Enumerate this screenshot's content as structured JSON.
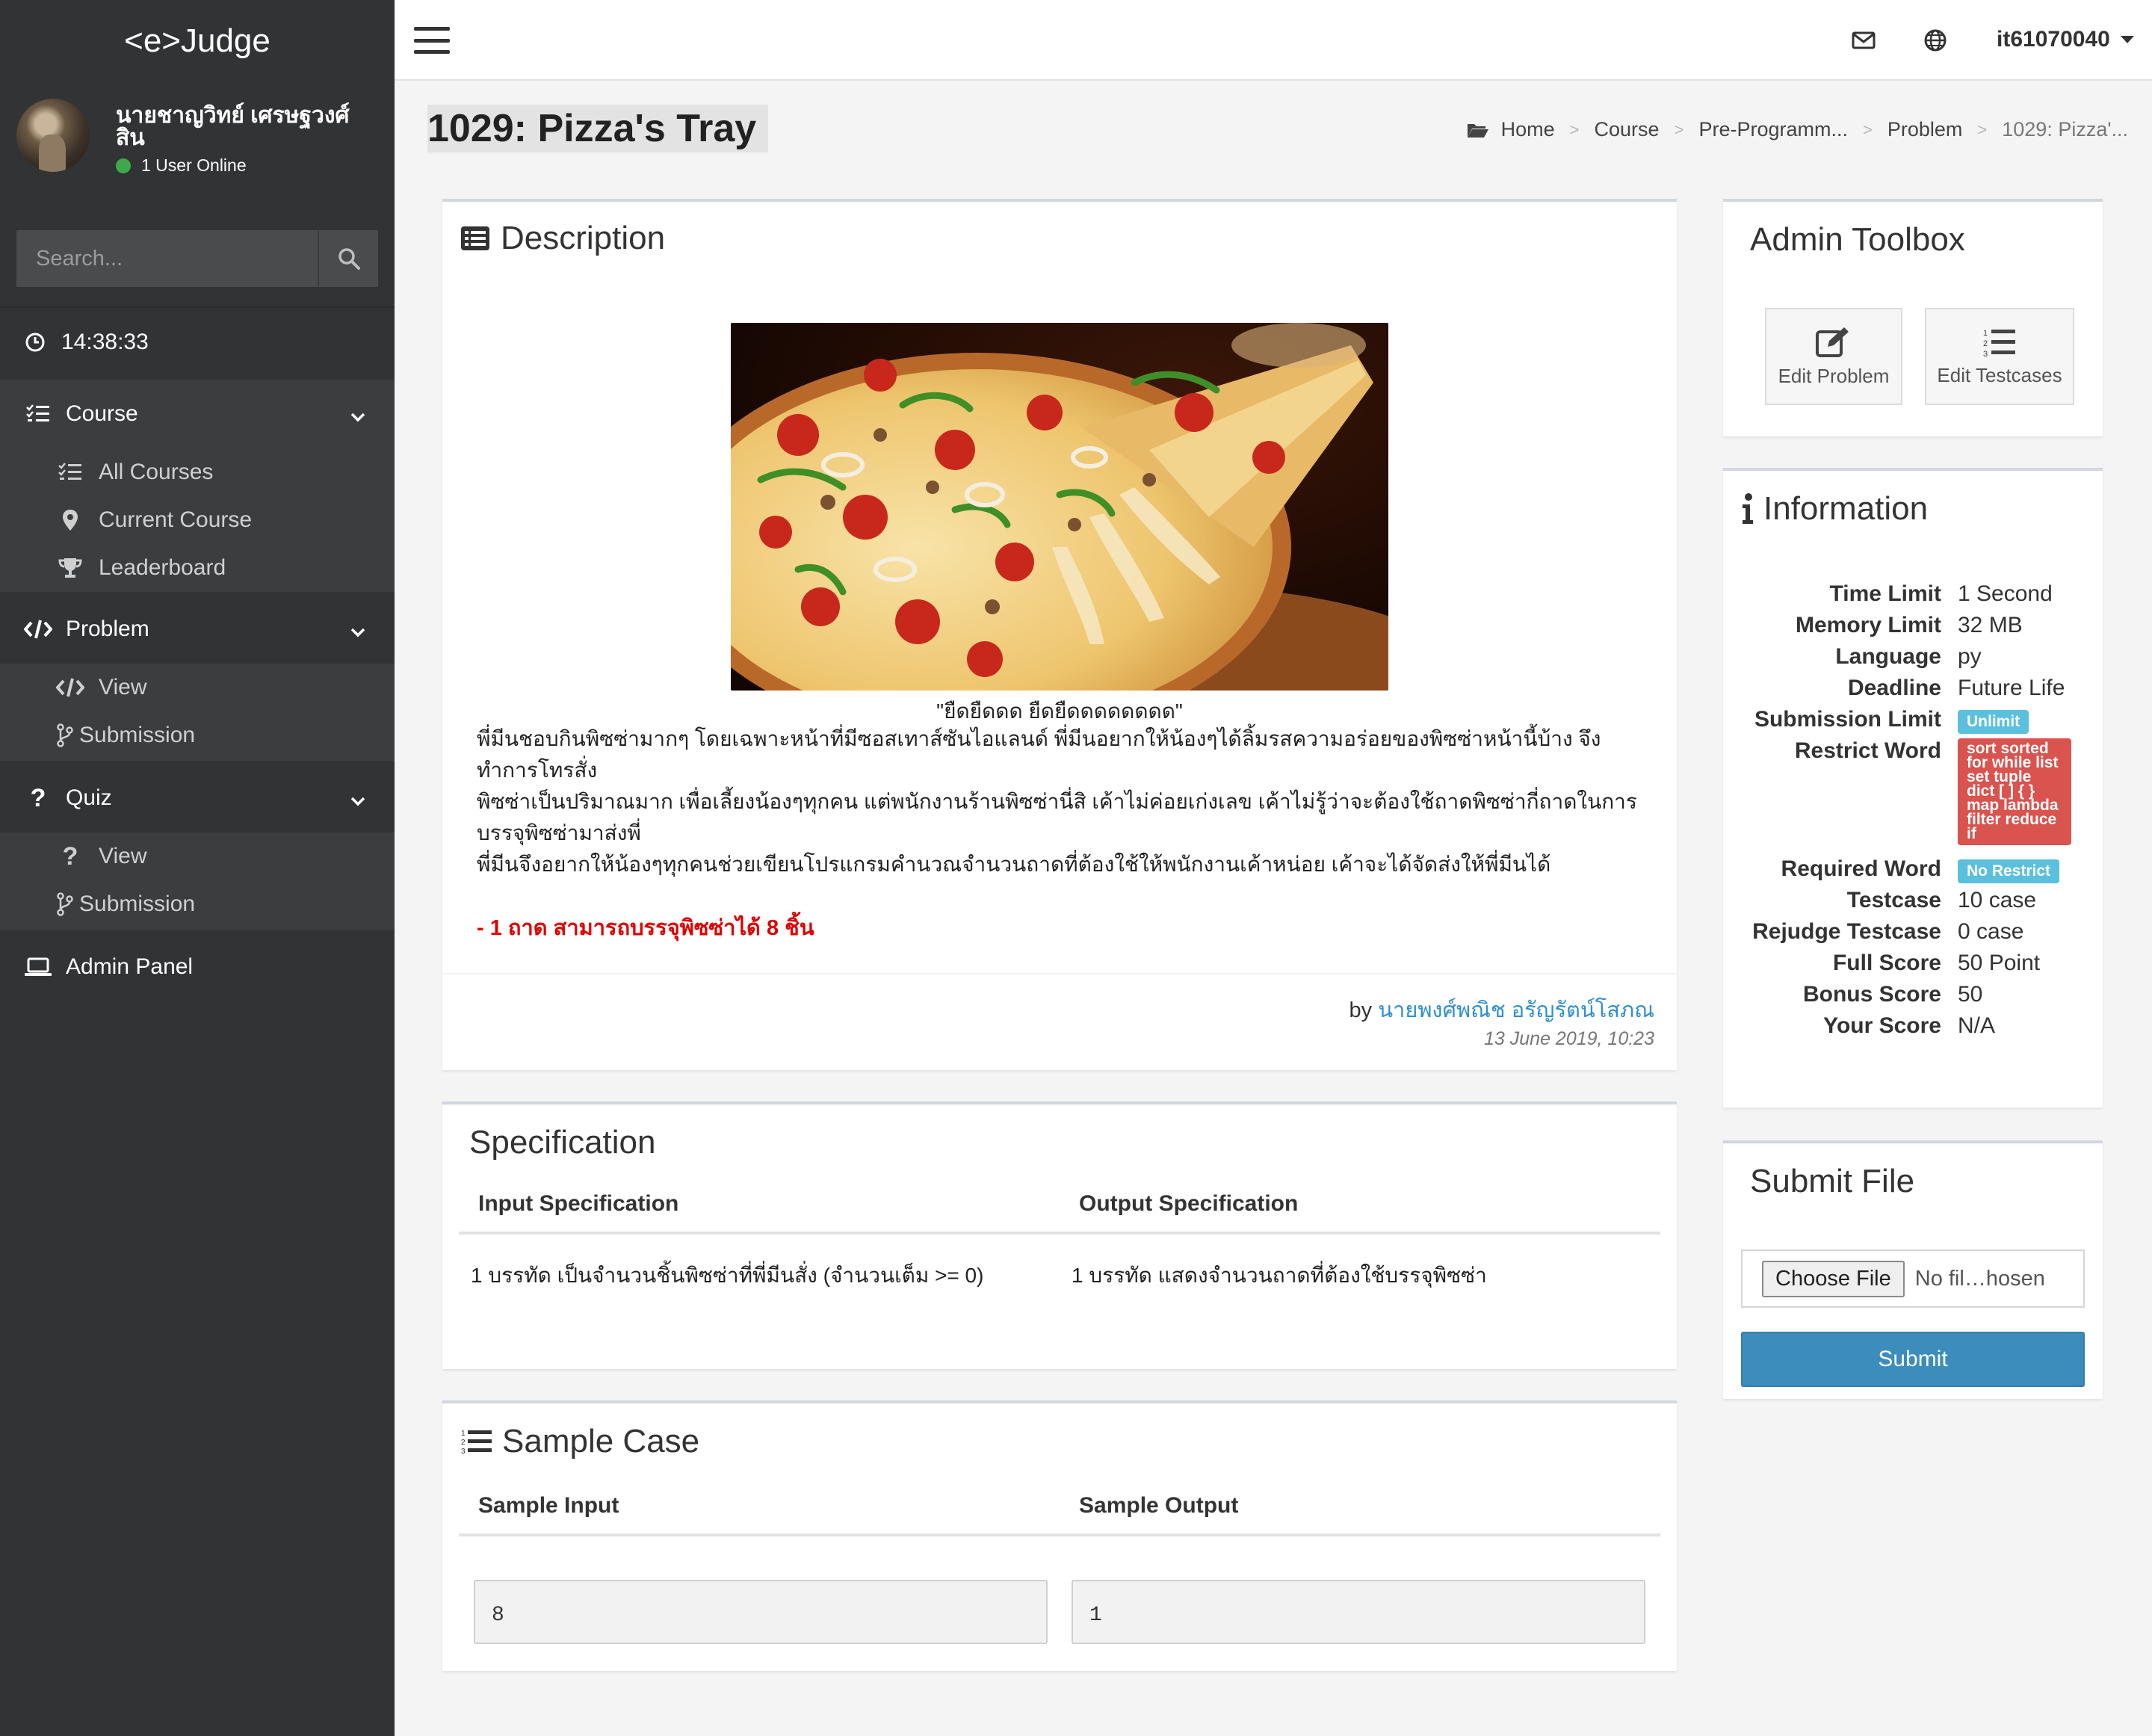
{
  "app": {
    "logo": "<e>Judge"
  },
  "sidebar": {
    "user_name": "นายชาญวิทย์ เศรษฐวงศ์สิน",
    "online_text": "1 User Online",
    "search_placeholder": "Search...",
    "time": "14:38:33",
    "sections": [
      {
        "label": "Course",
        "items": [
          "All Courses",
          "Current Course",
          "Leaderboard"
        ]
      },
      {
        "label": "Problem",
        "items": [
          "View",
          "Submission"
        ]
      },
      {
        "label": "Quiz",
        "items": [
          "View",
          "Submission"
        ]
      }
    ],
    "admin_panel": "Admin Panel"
  },
  "topbar": {
    "username": "it61070040"
  },
  "page": {
    "title": "1029: Pizza's Tray",
    "breadcrumb": [
      "Home",
      "Course",
      "Pre-Programm...",
      "Problem",
      "1029: Pizza'..."
    ]
  },
  "description": {
    "title": "Description",
    "caption": "\"ยืดยืดดด ยืดยืดดดดดดดด\"",
    "lines": [
      "    พี่มีนชอบกินพิซซ่ามากๆ โดยเฉพาะหน้าที่มีซอสเทาส์ซันไอแลนด์ พี่มีนอยากให้น้องๆได้ลิ้มรสความอร่อยของพิซซ่าหน้านี้บ้าง จึงทำการโทรสั่ง",
      "พิซซ่าเป็นปริมาณมาก เพื่อเลี้ยงน้องๆทุกคน แต่พนักงานร้านพิซซ่านี่สิ เค้าไม่ค่อยเก่งเลข เค้าไม่รู้ว่าจะต้องใช้ถาดพิซซ่ากี่ถาดในการบรรจุพิซซ่ามาส่งพี่",
      "พี่มีนจึงอยากให้น้องๆทุกคนช่วยเขียนโปรแกรมคำนวณจำนวนถาดที่ต้องใช้ให้พนักงานเค้าหน่อย เค้าจะได้จัดส่งให้พี่มีนได้"
    ],
    "note": "- 1 ถาด สามารถบรรจุพิซซ่าได้ 8 ชิ้น",
    "by_label": "by",
    "author": "นายพงศ์พณิช อรัญรัตน์โสภณ",
    "date": "13 June 2019, 10:23"
  },
  "specification": {
    "title": "Specification",
    "input_header": "Input Specification",
    "output_header": "Output Specification",
    "input_text": "1 บรรทัด เป็นจำนวนชิ้นพิซซ่าที่พี่มีนสั่ง (จำนวนเต็ม >= 0)",
    "output_text": "1 บรรทัด แสดงจำนวนถาดที่ต้องใช้บรรจุพิซซ่า"
  },
  "sample": {
    "title": "Sample Case",
    "input_header": "Sample Input",
    "output_header": "Sample Output",
    "input_value": "8",
    "output_value": "1"
  },
  "toolbox": {
    "title": "Admin Toolbox",
    "edit_problem": "Edit Problem",
    "edit_testcases": "Edit Testcases"
  },
  "information": {
    "title": "Information",
    "time_limit": {
      "label": "Time Limit",
      "value": "1 Second"
    },
    "memory_limit": {
      "label": "Memory Limit",
      "value": "32 MB"
    },
    "language": {
      "label": "Language",
      "value": "py"
    },
    "deadline": {
      "label": "Deadline",
      "value": "Future Life"
    },
    "submission_limit": {
      "label": "Submission Limit",
      "value": "Unlimit"
    },
    "restrict_word": {
      "label": "Restrict Word",
      "value": "sort sorted for while list set tuple dict [ ] { } map lambda filter reduce if"
    },
    "required_word": {
      "label": "Required Word",
      "value": "No Restrict"
    },
    "testcase": {
      "label": "Testcase",
      "value": "10 case"
    },
    "rejudge_testcase": {
      "label": "Rejudge Testcase",
      "value": "0 case"
    },
    "full_score": {
      "label": "Full Score",
      "value": "50 Point"
    },
    "bonus_score": {
      "label": "Bonus Score",
      "value": "50"
    },
    "your_score": {
      "label": "Your Score",
      "value": "N/A"
    }
  },
  "submit_file": {
    "title": "Submit File",
    "choose_label": "Choose File",
    "file_status": "No fil…hosen",
    "submit_label": "Submit"
  },
  "colors": {
    "sidebar_bg": "#313335",
    "sidebar_sub_bg": "#3b3d3f",
    "primary": "#3c8dbc",
    "badge_info": "#5bc0de",
    "badge_danger": "#d9534f",
    "note_red": "#e00000",
    "online_green": "#3ea84a"
  }
}
